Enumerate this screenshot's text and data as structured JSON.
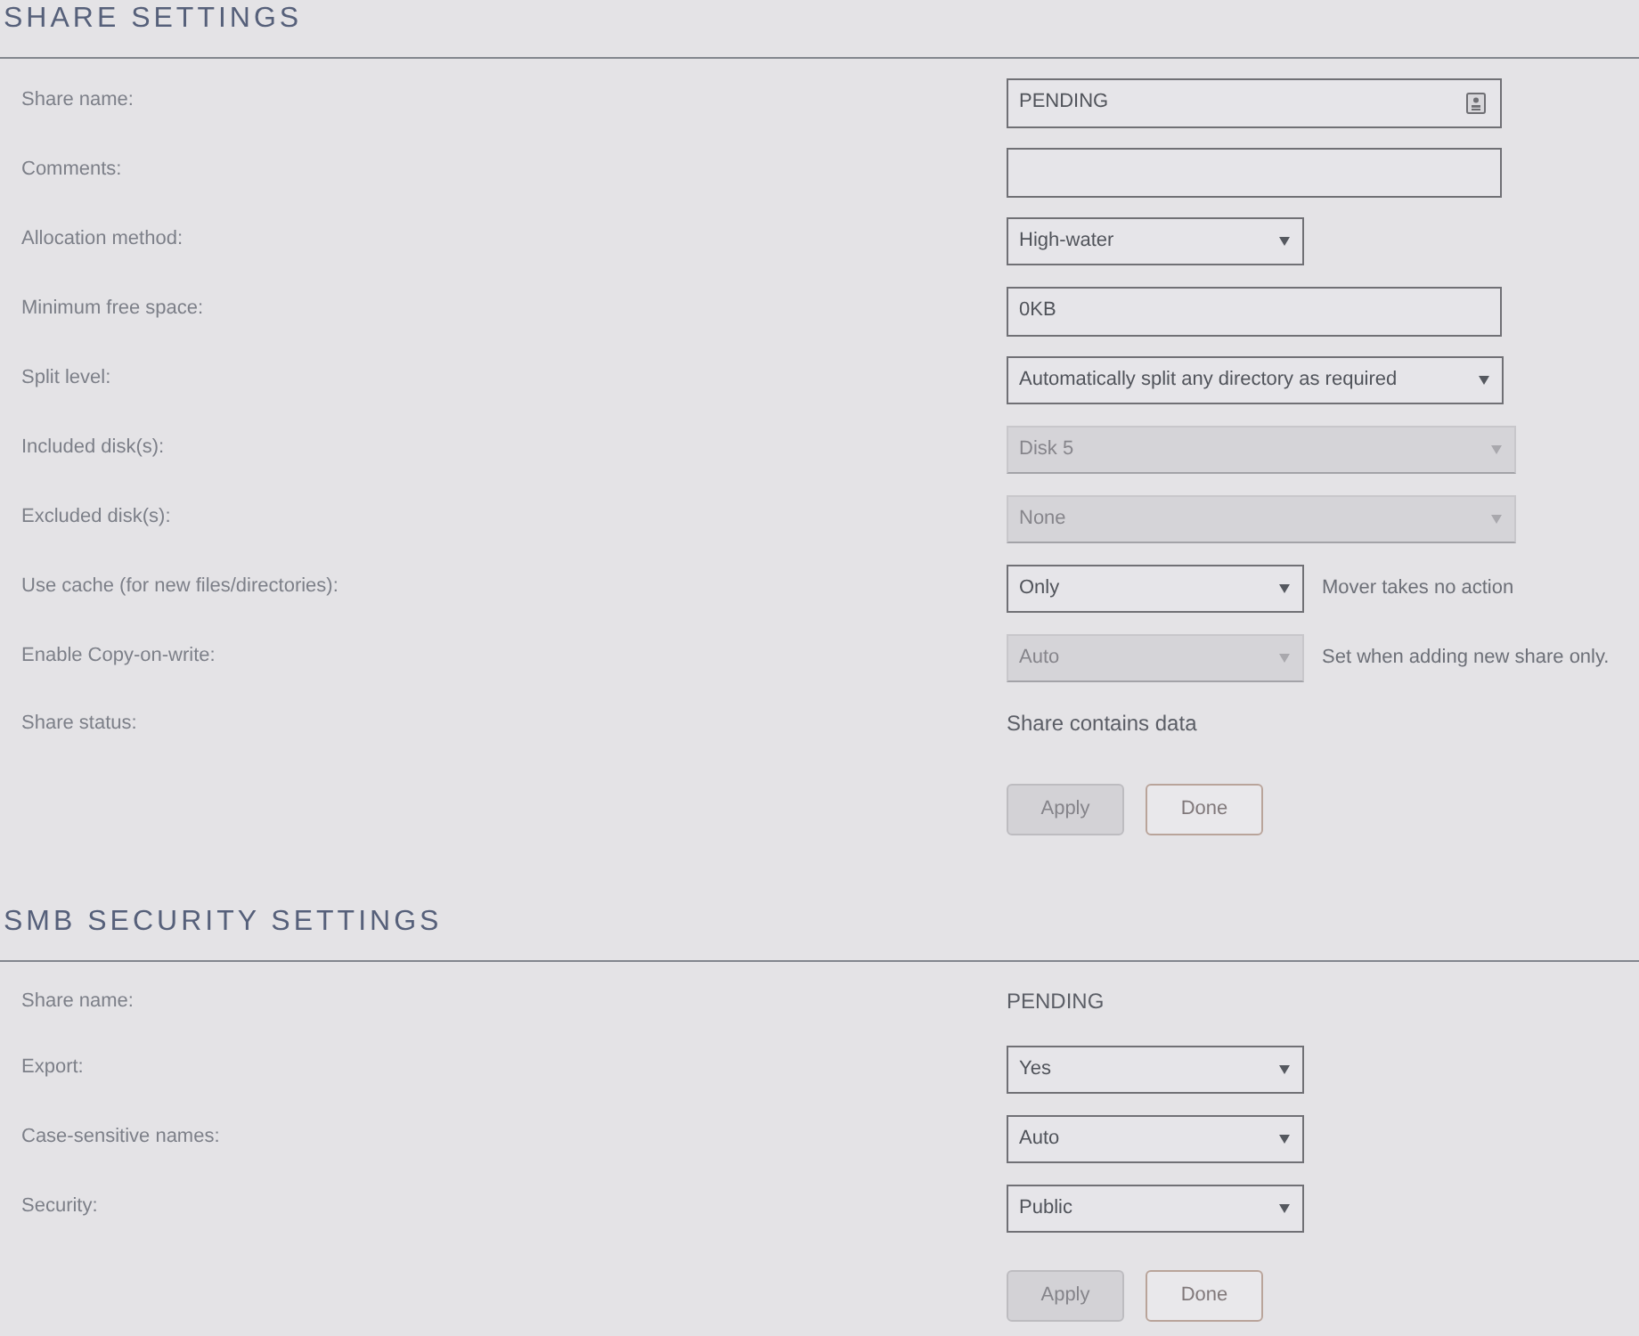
{
  "sections": [
    {
      "title": "SHARE SETTINGS",
      "fields": [
        {
          "label": "Share name:",
          "kind": "text",
          "value": "PENDING",
          "badge": true
        },
        {
          "label": "Comments:",
          "kind": "text"
        },
        {
          "label": "Allocation method:",
          "kind": "select",
          "value": "High-water",
          "disabled": false
        },
        {
          "label": "Minimum free space:",
          "kind": "text",
          "value": "0KB"
        },
        {
          "label": "Split level:",
          "kind": "wide-select",
          "value": "Automatically split any directory as required",
          "disabled": false
        },
        {
          "label": "Included disk(s):",
          "kind": "wide-select",
          "value": "Disk 5",
          "disabled": true
        },
        {
          "label": "Excluded disk(s):",
          "kind": "wide-select",
          "value": "None",
          "disabled": true
        },
        {
          "label": "Use cache (for new files/directories):",
          "kind": "select",
          "value": "Only",
          "disabled": false,
          "note": "Mover takes no action"
        },
        {
          "label": "Enable Copy-on-write:",
          "kind": "select",
          "value": "Auto",
          "disabled": true,
          "note": "Set when adding new share only."
        },
        {
          "label": "Share status:",
          "kind": "static",
          "value": "Share contains data"
        }
      ],
      "buttons": [
        {
          "label": "Apply",
          "disabled": true
        },
        {
          "label": "Done",
          "disabled": false
        }
      ]
    },
    {
      "title": "SMB SECURITY SETTINGS",
      "fields": [
        {
          "label": "Share name:",
          "kind": "static",
          "value": "PENDING"
        },
        {
          "label": "Export:",
          "kind": "select",
          "value": "Yes",
          "disabled": false
        },
        {
          "label": "Case-sensitive names:",
          "kind": "select",
          "value": "Auto",
          "disabled": false
        },
        {
          "label": "Security:",
          "kind": "select",
          "value": "Public",
          "disabled": false
        }
      ],
      "buttons": [
        {
          "label": "Apply",
          "disabled": true
        },
        {
          "label": "Done",
          "disabled": false
        }
      ]
    }
  ]
}
